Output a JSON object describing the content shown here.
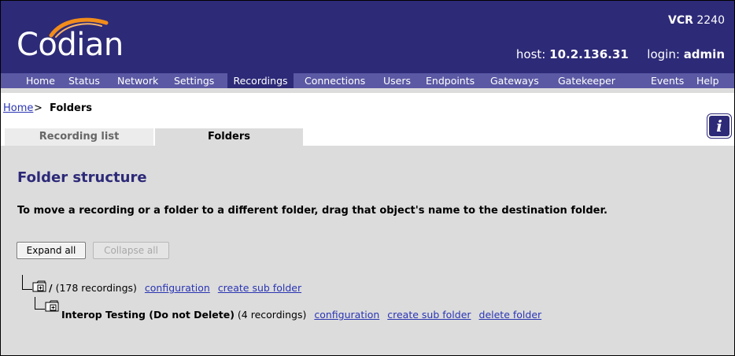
{
  "header": {
    "brand": "Codian",
    "product_model_prefix": "VCR",
    "product_model_number": "2240",
    "host_label": "host:",
    "host_value": "10.2.136.31",
    "login_label": "login:",
    "login_value": "admin"
  },
  "nav": {
    "items": [
      "Home",
      "Status",
      "Network",
      "Settings",
      "Recordings",
      "Connections",
      "Users",
      "Endpoints",
      "Gateways",
      "Gatekeeper",
      "Events",
      "Help"
    ],
    "active": "Recordings"
  },
  "breadcrumb": {
    "home": "Home",
    "separator": ">",
    "current": "Folders"
  },
  "tabs": {
    "recording_list": "Recording list",
    "folders": "Folders",
    "active": "Folders"
  },
  "main": {
    "title": "Folder structure",
    "instruction": "To move a recording or a folder to a different folder, drag that object's name to the destination folder.",
    "expand_all": "Expand all",
    "collapse_all": "Collapse all"
  },
  "tree": {
    "root": {
      "name": "/",
      "count": "(178 recordings)",
      "configuration": "configuration",
      "create_sub_folder": "create sub folder"
    },
    "child": {
      "name": "Interop Testing (Do not Delete)",
      "count": "(4 recordings)",
      "configuration": "configuration",
      "create_sub_folder": "create sub folder",
      "delete_folder": "delete folder"
    }
  },
  "colors": {
    "header_bg": "#2d2a78",
    "nav_bg": "#5b59a4",
    "link": "#2a35b3",
    "logo_arc": "#f28c1a"
  }
}
